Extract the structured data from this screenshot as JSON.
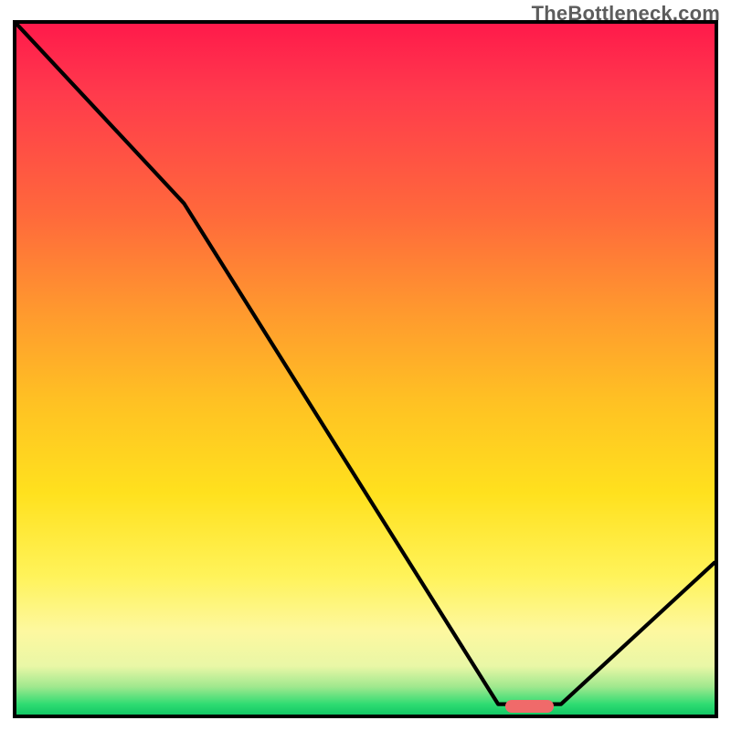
{
  "attribution": "TheBottleneck.com",
  "colors": {
    "frame": "#000000",
    "curve": "#000000",
    "marker": "#f06a6a"
  },
  "chart_data": {
    "type": "line",
    "title": "",
    "xlabel": "",
    "ylabel": "",
    "xlim": [
      0,
      1
    ],
    "ylim": [
      0,
      1
    ],
    "annotations": [
      {
        "text": "TheBottleneck.com",
        "position": "top-right"
      }
    ],
    "series": [
      {
        "name": "bottleneck-curve",
        "x": [
          0.0,
          0.24,
          0.69,
          0.78,
          1.0
        ],
        "y": [
          1.0,
          0.74,
          0.015,
          0.015,
          0.22
        ],
        "note": "y is bottleneck fraction (1=worst/red top, 0=best/green bottom); curve falls, flattens at valley, then rises"
      }
    ],
    "marker": {
      "name": "optimal-point",
      "x_center": 0.735,
      "y": 0.012,
      "width_frac": 0.07
    }
  }
}
